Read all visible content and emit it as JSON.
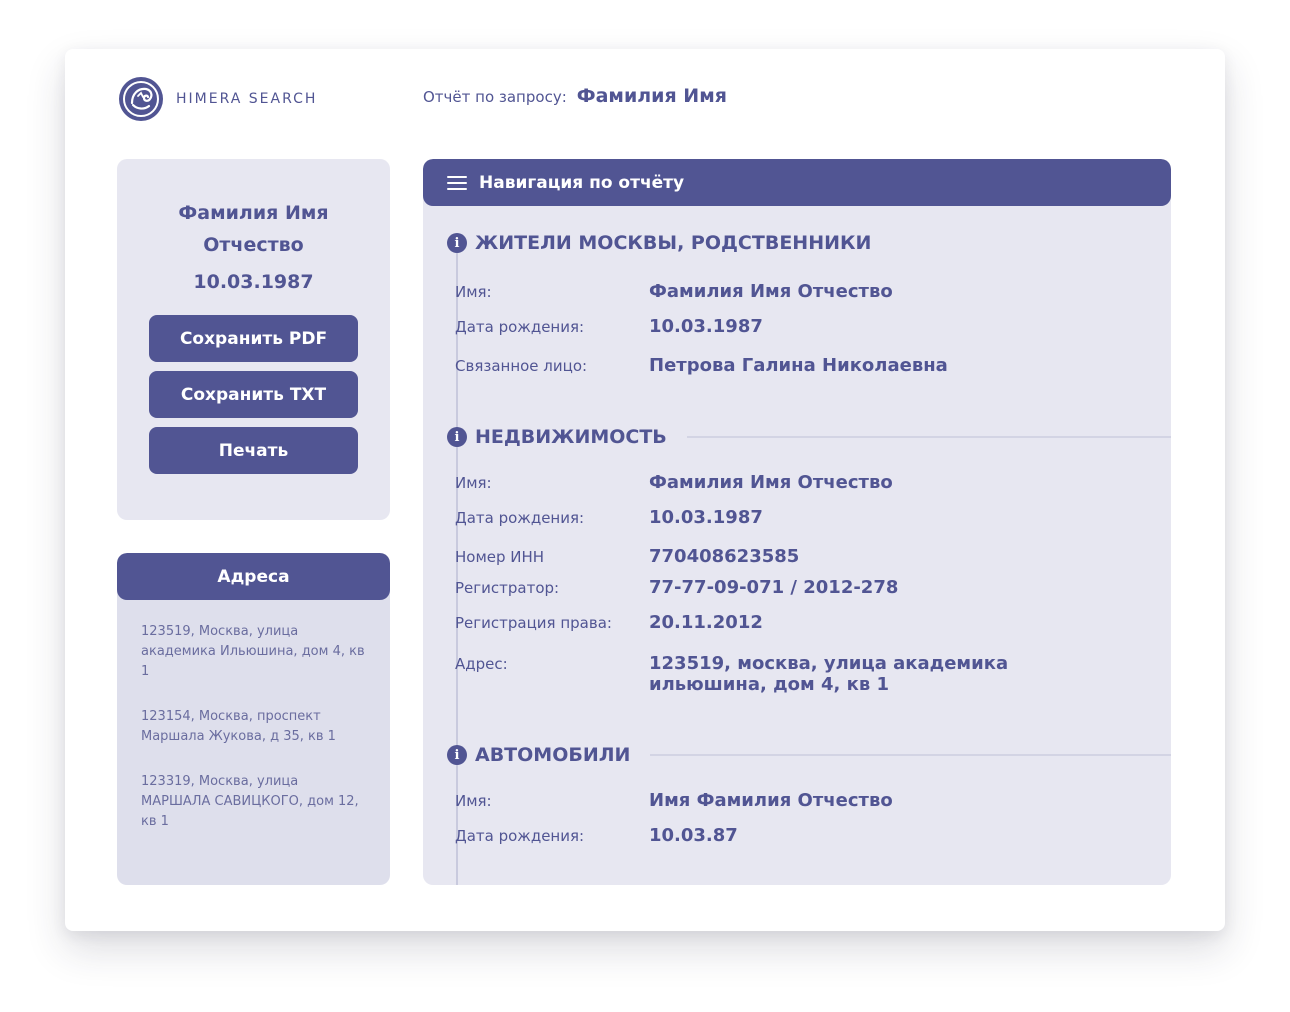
{
  "brand": {
    "name": "HIMERA SEARCH",
    "logo_icon": "chimera-logo-icon"
  },
  "query": {
    "label": "Отчёт по запросу:",
    "value": "Фамилия Имя"
  },
  "profile": {
    "name": "Фамилия Имя Отчество",
    "dob": "10.03.1987",
    "buttons": {
      "save_pdf": "Сохранить PDF",
      "save_txt": "Сохранить TXT",
      "print": "Печать"
    }
  },
  "addresses": {
    "title": "Адреса",
    "items": [
      "123519, Москва, улица академика Ильюшина, дом 4, кв 1",
      "123154, Москва, проспект Маршала Жукова, д 35, кв 1",
      "123319, Москва, улица МАРШАЛА САВИЦКОГО, дом 12, кв 1"
    ]
  },
  "report": {
    "nav_label": "Навигация по отчёту",
    "sections": [
      {
        "title": "ЖИТЕЛИ МОСКВЫ, РОДСТВЕННИКИ",
        "rows": [
          {
            "label": "Имя:",
            "value": "Фамилия Имя Отчество"
          },
          {
            "label": "Дата рождения:",
            "value": "10.03.1987"
          },
          {
            "label": "Связанное лицо:",
            "value": "Петрова Галина Николаевна"
          }
        ]
      },
      {
        "title": "НЕДВИЖИМОСТЬ",
        "rows": [
          {
            "label": "Имя:",
            "value": "Фамилия Имя Отчество"
          },
          {
            "label": "Дата рождения:",
            "value": "10.03.1987"
          },
          {
            "label": "Номер ИНН",
            "value": "770408623585"
          },
          {
            "label": "Регистратор:",
            "value": "77-77-09-071 / 2012-278"
          },
          {
            "label": "Регистрация права:",
            "value": "20.11.2012"
          },
          {
            "label": "Адрес:",
            "value": "123519, москва, улица академика ильюшина, дом 4, кв 1"
          }
        ]
      },
      {
        "title": "АВТОМОБИЛИ",
        "rows": [
          {
            "label": "Имя:",
            "value": "Имя Фамилия Отчество"
          },
          {
            "label": "Дата рождения:",
            "value": "10.03.87"
          }
        ]
      }
    ]
  },
  "colors": {
    "accent": "#515593",
    "panel": "#e7e7f1",
    "address_panel": "#dedfec"
  }
}
